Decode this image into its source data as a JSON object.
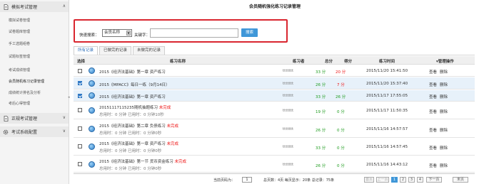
{
  "sidebar": {
    "sections": [
      {
        "label": "模拟考试管理",
        "icon": "document-icon"
      },
      {
        "label": "正规考试管理",
        "icon": "document-icon"
      },
      {
        "label": "考试系统配置",
        "icon": "gear-icon"
      }
    ],
    "items": [
      "模拟试卷管理",
      "试卷题库管理",
      "手工选题组卷",
      "试题标签管理",
      "考试成绩管理",
      "会员随机练习记录管理",
      "成绩统计排名及分析",
      "考后心得管理"
    ],
    "active_index": 5
  },
  "page_title": "会员随机强化练习记录管理",
  "search": {
    "label": "快速搜索：",
    "select_value": "会员名称",
    "keyword_label": "关键字：",
    "keyword_value": "",
    "button": "搜索"
  },
  "tabs": [
    "所有记录",
    "已做完的记录",
    "未做完的记录"
  ],
  "table": {
    "headers": [
      "选择",
      "练习名称",
      "练习者",
      "总分",
      "得分",
      "练习时间",
      "管理操作"
    ],
    "rows": [
      {
        "name": "2015《经济法基础》第一章 资产练习",
        "status": "",
        "user": "ttttttt",
        "total": "33 分",
        "score": "20 分",
        "time": "2015/11/20 15:41:50",
        "checked": false,
        "sub": ""
      },
      {
        "name": "2015《MPACC》每日一练（9月14日）",
        "status": "",
        "user": "ttttttt",
        "total": "26 分",
        "score": "7 分",
        "time": "2015/11/20 15:37:40",
        "checked": true,
        "sub": ""
      },
      {
        "name": "2015《经济法基础》第一章 资产练习",
        "status": "",
        "user": "ttttttt",
        "total": "33 分",
        "score": "26 分",
        "time": "2015/11/17 17:55:05",
        "checked": true,
        "sub": ""
      },
      {
        "name": "20151117115235随机抽题练习",
        "status": "未完成",
        "user": "ttttttt",
        "total": "19 分",
        "score": "0 分",
        "time": "2015/11/17 11:50:35",
        "checked": false,
        "sub": "总用时：0 分钟 已用时：0 分钟10秒"
      },
      {
        "name": "2015《经济法基础》第二章 负债练习",
        "status": "未完成",
        "user": "ttttttt",
        "total": "26 分",
        "score": "0 分",
        "time": "2015/11/16 14:57:57",
        "checked": false,
        "sub": "总用时：0 分钟 已用时：0 分钟0秒"
      },
      {
        "name": "2015《经济法基础》第一章 资产练习",
        "status": "未完成",
        "user": "ttttttt",
        "total": "33 分",
        "score": "0 分",
        "time": "2015/11/16 14:57:45",
        "checked": false,
        "sub": "总用时：0 分钟 已用时：0 分钟0秒"
      },
      {
        "name": "2015《经济法基础》第一节 货币资金练习",
        "status": "未完成",
        "user": "ttttttt",
        "total": "26 分",
        "score": "0 分",
        "time": "2015/11/16 14:43:12",
        "checked": false,
        "sub": "总用时：0 分钟 已用时：0 分钟0秒"
      }
    ],
    "action_view": "查看",
    "action_delete": "删除"
  },
  "pager": {
    "current_label": "当前页码为：",
    "current_value": "1",
    "summary": "总页数：4页 每页显示：20条 总记录：75条",
    "first": "首页",
    "prev": "上一页",
    "pages": [
      "1",
      "2",
      "3",
      "4"
    ],
    "next": "下一页",
    "last": "末页"
  },
  "colors": {
    "accent": "#3f97d8",
    "highlight_border": "#d9262f",
    "green": "#1a9a1a",
    "red": "#e11111"
  }
}
